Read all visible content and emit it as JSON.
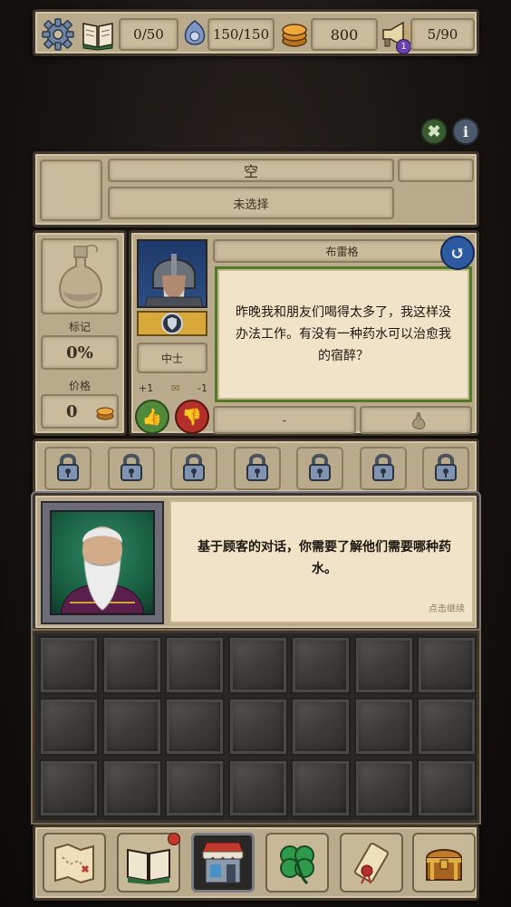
{
  "topbar": {
    "book_count": "0/50",
    "mana": "150/150",
    "gold": "800",
    "reputation": "5/90",
    "notification_badge": "1"
  },
  "info_button": "i",
  "selected": {
    "title": "空",
    "subtitle": "未选择"
  },
  "pricing": {
    "mark_label": "标记",
    "mark_value": "0%",
    "price_label": "价格",
    "price_value": "0"
  },
  "customer": {
    "name": "布雷格",
    "rank": "中士",
    "rep_plus": "+1",
    "rep_minus": "-1",
    "dialogue": "昨晚我和朋友们喝得太多了，我这样没办法工作。有没有一种药水可以治愈我的宿醉？",
    "requested_item": "-"
  },
  "tutorial": {
    "text": "基于顾客的对话，你需要了解他们需要哪种药水。",
    "continue_hint": "点击继续"
  },
  "locks": [
    "lock",
    "lock",
    "lock",
    "lock",
    "lock",
    "lock",
    "lock"
  ],
  "bottom_nav": [
    "map-icon",
    "recipe-book-icon",
    "shop-icon",
    "clover-icon",
    "scroll-icon",
    "treasure-chest-icon"
  ],
  "colors": {
    "panel": "#b9aa8c",
    "dialogue_bg": "#f1e3c8",
    "dialogue_border": "#4f7a2a",
    "accent_blue": "#2d5aa0",
    "like_green": "#4f8a3a",
    "dislike_red": "#b3302a"
  }
}
